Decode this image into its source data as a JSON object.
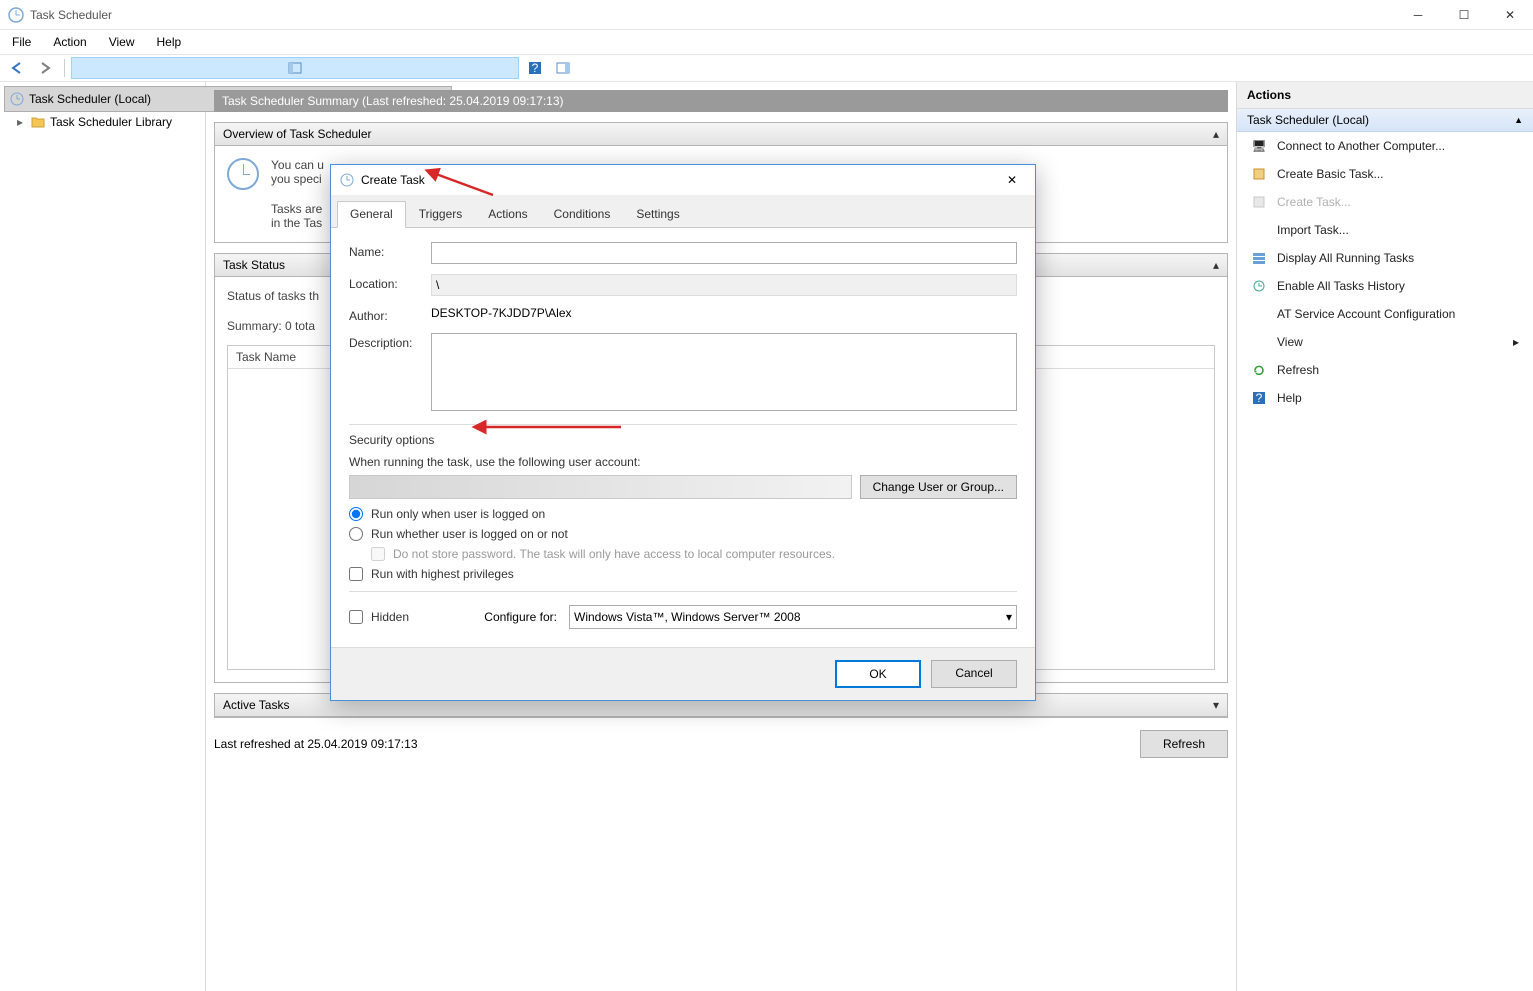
{
  "title": "Task Scheduler",
  "menus": [
    "File",
    "Action",
    "View",
    "Help"
  ],
  "tree": {
    "root": "Task Scheduler (Local)",
    "child": "Task Scheduler Library"
  },
  "summary_header": "Task Scheduler Summary (Last refreshed: 25.04.2019 09:17:13)",
  "overview": {
    "title": "Overview of Task Scheduler",
    "line1": "You can u",
    "line2": "you speci",
    "line3": "Tasks are",
    "line4": "in the Tas"
  },
  "taskstatus": {
    "title": "Task Status",
    "statusof": "Status of tasks th",
    "summary": "Summary: 0 tota",
    "col1": "Task Name"
  },
  "activetasks": {
    "title": "Active Tasks"
  },
  "lastrefreshed": "Last refreshed at 25.04.2019 09:17:13",
  "refresh_btn": "Refresh",
  "actions": {
    "header": "Actions",
    "sub": "Task Scheduler (Local)",
    "items": [
      "Connect to Another Computer...",
      "Create Basic Task...",
      "Create Task...",
      "Import Task...",
      "Display All Running Tasks",
      "Enable All Tasks History",
      "AT Service Account Configuration",
      "View",
      "Refresh",
      "Help"
    ]
  },
  "dialog": {
    "title": "Create Task",
    "tabs": [
      "General",
      "Triggers",
      "Actions",
      "Conditions",
      "Settings"
    ],
    "name_lbl": "Name:",
    "location_lbl": "Location:",
    "location_val": "\\",
    "author_lbl": "Author:",
    "author_val": "DESKTOP-7KJDD7P\\Alex",
    "desc_lbl": "Description:",
    "sec_lbl": "Security options",
    "sec_when": "When running the task, use the following user account:",
    "change_btn": "Change User or Group...",
    "radio1": "Run only when user is logged on",
    "radio2": "Run whether user is logged on or not",
    "check_nopwd": "Do not store password.  The task will only have access to local computer resources.",
    "check_highest": "Run with highest privileges",
    "hidden_lbl": "Hidden",
    "cfgfor_lbl": "Configure for:",
    "cfgfor_val": "Windows Vista™, Windows Server™ 2008",
    "ok": "OK",
    "cancel": "Cancel"
  }
}
